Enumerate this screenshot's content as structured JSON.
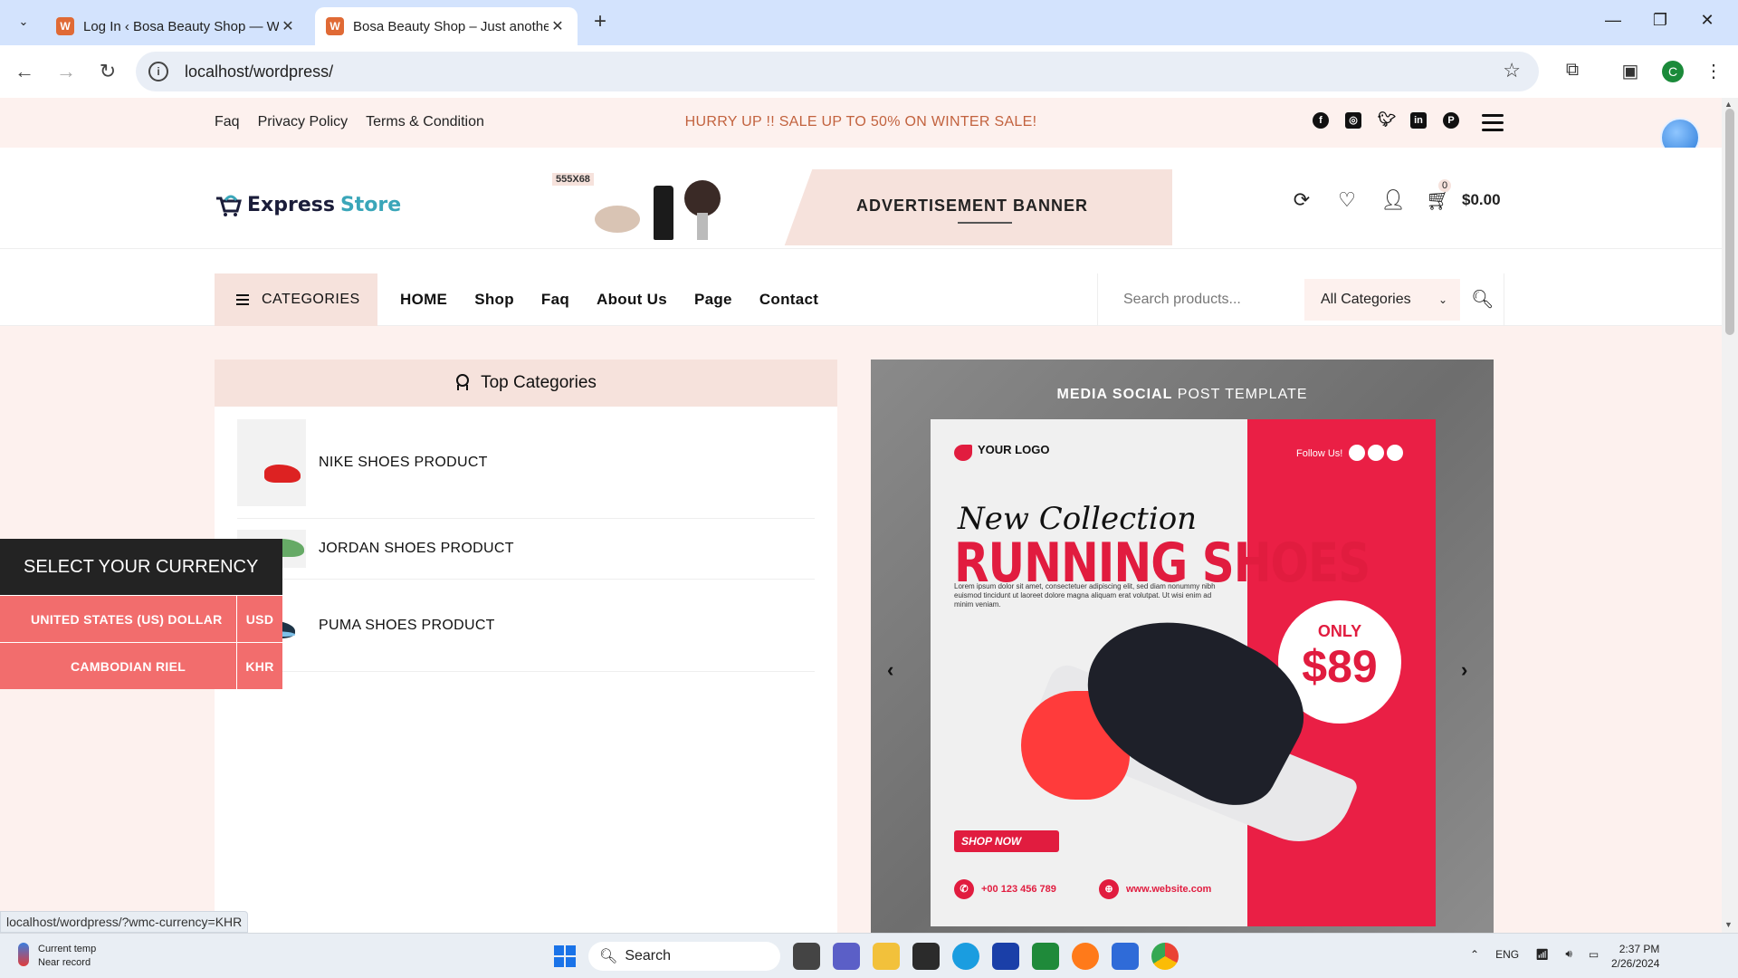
{
  "browser": {
    "tabs": [
      {
        "title": "Log In ‹ Bosa Beauty Shop — W",
        "active": false
      },
      {
        "title": "Bosa Beauty Shop – Just anothe",
        "active": true
      }
    ],
    "url": "localhost/wordpress/",
    "profile_initial": "C",
    "status_url": "localhost/wordpress/?wmc-currency=KHR"
  },
  "topbar": {
    "links": [
      "Faq",
      "Privacy Policy",
      "Terms & Condition"
    ],
    "sale_text": "HURRY UP !! SALE UP TO 50% ON WINTER SALE!",
    "social_icons": [
      "facebook-icon",
      "instagram-icon",
      "twitter-icon",
      "linkedin-icon",
      "pinterest-icon"
    ]
  },
  "header": {
    "logo_word1": "Express",
    "logo_word2": "Store",
    "banner_size": "555X68",
    "banner_text": "ADVERTISEMENT BANNER",
    "cart_count": "0",
    "cart_total": "$0.00"
  },
  "nav": {
    "categories_label": "CATEGORIES",
    "menu": [
      "HOME",
      "Shop",
      "Faq",
      "About Us",
      "Page",
      "Contact"
    ],
    "search_placeholder": "Search products...",
    "search_category": "All Categories"
  },
  "top_categories": {
    "title": "Top Categories",
    "items": [
      "NIKE SHOES PRODUCT",
      "JORDAN SHOES PRODUCT",
      "PUMA SHOES PRODUCT"
    ]
  },
  "slider": {
    "heading_bold": "MEDIA SOCIAL",
    "heading_rest": " POST TEMPLATE",
    "your_logo": "YOUR LOGO",
    "follow": "Follow Us!",
    "new_collection": "New Collection",
    "headline": "RUNNING SHOES",
    "lorem": "Lorem ipsum dolor sit amet, consectetuer adipiscing elit, sed diam nonummy nibh euismod tincidunt ut laoreet dolore magna aliquam erat volutpat. Ut wisi enim ad minim veniam.",
    "only": "ONLY",
    "price": "$89",
    "shop_now": "SHOP NOW",
    "phone": "+00 123 456 789",
    "website": "www.website.com"
  },
  "currency": {
    "title": "SELECT YOUR CURRENCY",
    "options": [
      {
        "name": "UNITED STATES (US) DOLLAR",
        "code": "USD"
      },
      {
        "name": "CAMBODIAN RIEL",
        "code": "KHR"
      }
    ]
  },
  "taskbar": {
    "weather_line1": "Current temp",
    "weather_line2": "Near record",
    "search_label": "Search",
    "lang": "ENG",
    "time": "2:37 PM",
    "date": "2/26/2024"
  }
}
